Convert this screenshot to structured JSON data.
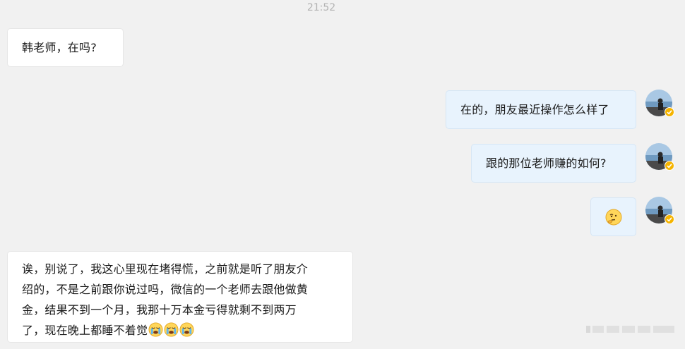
{
  "timestamp": "21:52",
  "messages": [
    {
      "direction": "incoming",
      "text": "韩老师，在吗?"
    },
    {
      "direction": "outgoing",
      "text": "在的，朋友最近操作怎么样了"
    },
    {
      "direction": "outgoing",
      "text": "跟的那位老师赚的如何?"
    },
    {
      "direction": "outgoing",
      "emoji": "thinking-face-emoji"
    },
    {
      "direction": "incoming",
      "lines": [
        "诶，别说了，我这心里现在堵得慌，之前就是听了朋友介",
        "绍的，不是之前跟你说过吗，微信的一个老师去跟他做黄",
        "金，结果不到一个月，我那十万本金亏得就剩不到两万",
        "了，现在晚上都睡不着觉"
      ],
      "trailing_emojis": [
        "crying-face-emoji",
        "crying-face-emoji",
        "crying-face-emoji"
      ]
    }
  ],
  "colors": {
    "background": "#f1f1f1",
    "incoming_bubble": "#ffffff",
    "outgoing_bubble": "#e8f3fd",
    "verified_badge": "#f5b400"
  },
  "icons": [
    "avatar-photo",
    "verified-badge-icon"
  ]
}
